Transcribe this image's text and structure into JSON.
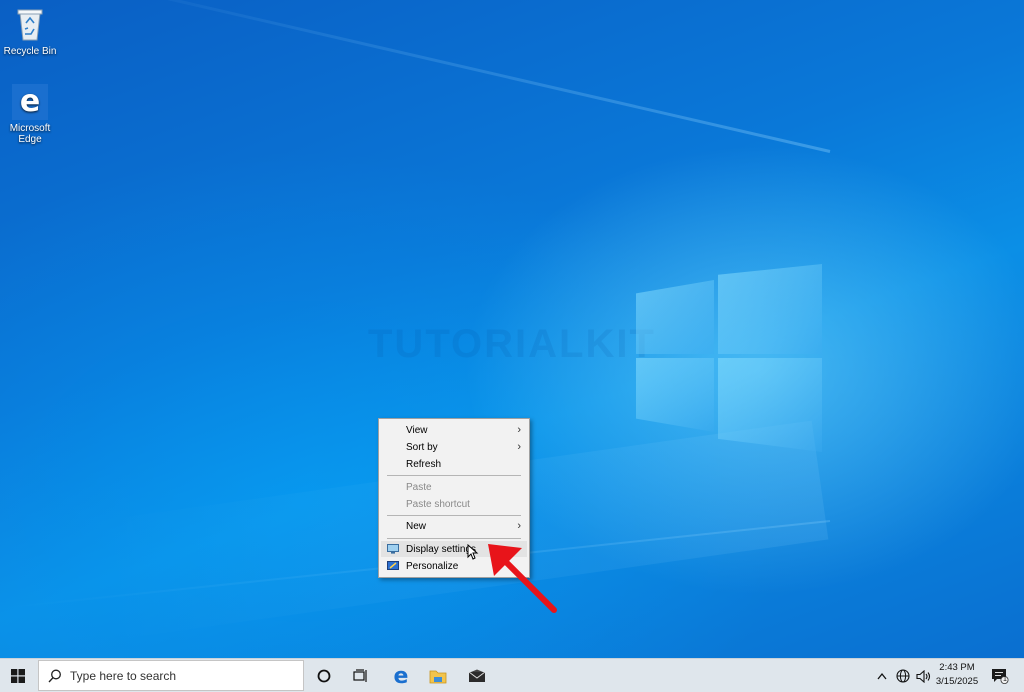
{
  "desktop": {
    "icons": [
      {
        "label": "Recycle Bin",
        "icon": "recycle-bin-icon"
      },
      {
        "label": "Microsoft Edge",
        "icon": "edge-icon"
      }
    ],
    "watermark": "TUTORIALKIT"
  },
  "context_menu": {
    "items": [
      {
        "label": "View",
        "has_submenu": true
      },
      {
        "label": "Sort by",
        "has_submenu": true
      },
      {
        "label": "Refresh"
      },
      {
        "label": "Paste",
        "disabled": true
      },
      {
        "label": "Paste shortcut",
        "disabled": true
      },
      {
        "label": "New",
        "has_submenu": true
      },
      {
        "label": "Display settings",
        "icon": "display-settings-icon"
      },
      {
        "label": "Personalize",
        "icon": "personalize-icon"
      }
    ]
  },
  "taskbar": {
    "search_placeholder": "Type here to search",
    "pinned": [
      "cortana-icon",
      "task-view-icon",
      "edge-icon",
      "file-explorer-icon",
      "mail-icon"
    ],
    "tray": [
      "chevron-up-icon",
      "network-globe-icon",
      "volume-icon"
    ],
    "time": "2:43 PM",
    "date": "3/15/2025",
    "notification_count": "1"
  },
  "colors": {
    "accent_arrow": "#e8141a",
    "taskbar_bg": "#dfe6ec",
    "menu_bg": "#f2f2f2"
  }
}
